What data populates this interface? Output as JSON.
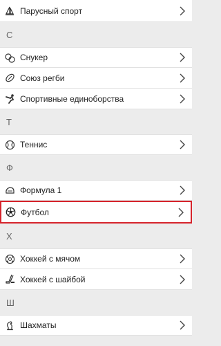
{
  "sections": [
    {
      "header": "",
      "items": [
        {
          "label": "Парусный спорт",
          "icon": "sailing-icon"
        }
      ]
    },
    {
      "header": "С",
      "items": [
        {
          "label": "Снукер",
          "icon": "snooker-icon"
        },
        {
          "label": "Союз регби",
          "icon": "rugby-icon"
        },
        {
          "label": "Спортивные единоборства",
          "icon": "martial-arts-icon"
        }
      ]
    },
    {
      "header": "Т",
      "items": [
        {
          "label": "Теннис",
          "icon": "tennis-icon"
        }
      ]
    },
    {
      "header": "Ф",
      "items": [
        {
          "label": "Формула 1",
          "icon": "formula1-icon"
        },
        {
          "label": "Футбол",
          "icon": "football-icon",
          "highlighted": true
        }
      ]
    },
    {
      "header": "Х",
      "items": [
        {
          "label": "Хоккей с мячом",
          "icon": "bandy-icon"
        },
        {
          "label": "Хоккей с шайбой",
          "icon": "ice-hockey-icon"
        }
      ]
    },
    {
      "header": "Ш",
      "items": [
        {
          "label": "Шахматы",
          "icon": "chess-icon"
        }
      ]
    }
  ],
  "colors": {
    "highlight_border": "#d6242c",
    "section_background": "#ececec",
    "row_background": "#ffffff"
  }
}
